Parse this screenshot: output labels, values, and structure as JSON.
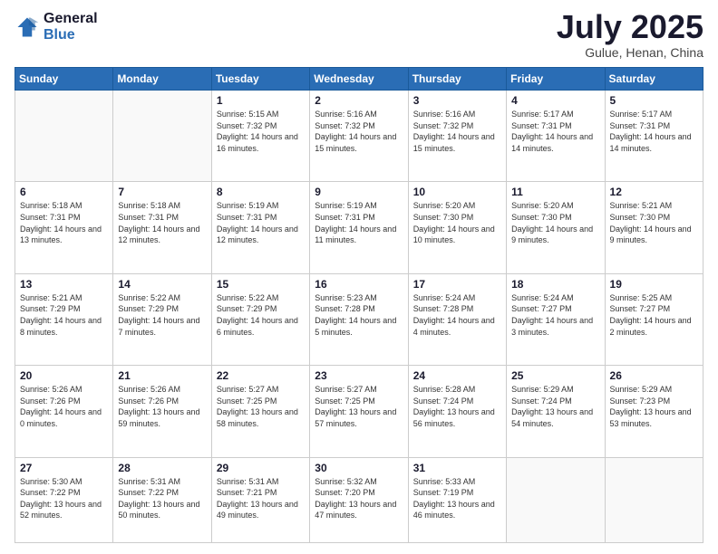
{
  "header": {
    "logo_general": "General",
    "logo_blue": "Blue",
    "month_title": "July 2025",
    "subtitle": "Gulue, Henan, China"
  },
  "weekdays": [
    "Sunday",
    "Monday",
    "Tuesday",
    "Wednesday",
    "Thursday",
    "Friday",
    "Saturday"
  ],
  "weeks": [
    [
      {
        "day": "",
        "info": ""
      },
      {
        "day": "",
        "info": ""
      },
      {
        "day": "1",
        "info": "Sunrise: 5:15 AM\nSunset: 7:32 PM\nDaylight: 14 hours and 16 minutes."
      },
      {
        "day": "2",
        "info": "Sunrise: 5:16 AM\nSunset: 7:32 PM\nDaylight: 14 hours and 15 minutes."
      },
      {
        "day": "3",
        "info": "Sunrise: 5:16 AM\nSunset: 7:32 PM\nDaylight: 14 hours and 15 minutes."
      },
      {
        "day": "4",
        "info": "Sunrise: 5:17 AM\nSunset: 7:31 PM\nDaylight: 14 hours and 14 minutes."
      },
      {
        "day": "5",
        "info": "Sunrise: 5:17 AM\nSunset: 7:31 PM\nDaylight: 14 hours and 14 minutes."
      }
    ],
    [
      {
        "day": "6",
        "info": "Sunrise: 5:18 AM\nSunset: 7:31 PM\nDaylight: 14 hours and 13 minutes."
      },
      {
        "day": "7",
        "info": "Sunrise: 5:18 AM\nSunset: 7:31 PM\nDaylight: 14 hours and 12 minutes."
      },
      {
        "day": "8",
        "info": "Sunrise: 5:19 AM\nSunset: 7:31 PM\nDaylight: 14 hours and 12 minutes."
      },
      {
        "day": "9",
        "info": "Sunrise: 5:19 AM\nSunset: 7:31 PM\nDaylight: 14 hours and 11 minutes."
      },
      {
        "day": "10",
        "info": "Sunrise: 5:20 AM\nSunset: 7:30 PM\nDaylight: 14 hours and 10 minutes."
      },
      {
        "day": "11",
        "info": "Sunrise: 5:20 AM\nSunset: 7:30 PM\nDaylight: 14 hours and 9 minutes."
      },
      {
        "day": "12",
        "info": "Sunrise: 5:21 AM\nSunset: 7:30 PM\nDaylight: 14 hours and 9 minutes."
      }
    ],
    [
      {
        "day": "13",
        "info": "Sunrise: 5:21 AM\nSunset: 7:29 PM\nDaylight: 14 hours and 8 minutes."
      },
      {
        "day": "14",
        "info": "Sunrise: 5:22 AM\nSunset: 7:29 PM\nDaylight: 14 hours and 7 minutes."
      },
      {
        "day": "15",
        "info": "Sunrise: 5:22 AM\nSunset: 7:29 PM\nDaylight: 14 hours and 6 minutes."
      },
      {
        "day": "16",
        "info": "Sunrise: 5:23 AM\nSunset: 7:28 PM\nDaylight: 14 hours and 5 minutes."
      },
      {
        "day": "17",
        "info": "Sunrise: 5:24 AM\nSunset: 7:28 PM\nDaylight: 14 hours and 4 minutes."
      },
      {
        "day": "18",
        "info": "Sunrise: 5:24 AM\nSunset: 7:27 PM\nDaylight: 14 hours and 3 minutes."
      },
      {
        "day": "19",
        "info": "Sunrise: 5:25 AM\nSunset: 7:27 PM\nDaylight: 14 hours and 2 minutes."
      }
    ],
    [
      {
        "day": "20",
        "info": "Sunrise: 5:26 AM\nSunset: 7:26 PM\nDaylight: 14 hours and 0 minutes."
      },
      {
        "day": "21",
        "info": "Sunrise: 5:26 AM\nSunset: 7:26 PM\nDaylight: 13 hours and 59 minutes."
      },
      {
        "day": "22",
        "info": "Sunrise: 5:27 AM\nSunset: 7:25 PM\nDaylight: 13 hours and 58 minutes."
      },
      {
        "day": "23",
        "info": "Sunrise: 5:27 AM\nSunset: 7:25 PM\nDaylight: 13 hours and 57 minutes."
      },
      {
        "day": "24",
        "info": "Sunrise: 5:28 AM\nSunset: 7:24 PM\nDaylight: 13 hours and 56 minutes."
      },
      {
        "day": "25",
        "info": "Sunrise: 5:29 AM\nSunset: 7:24 PM\nDaylight: 13 hours and 54 minutes."
      },
      {
        "day": "26",
        "info": "Sunrise: 5:29 AM\nSunset: 7:23 PM\nDaylight: 13 hours and 53 minutes."
      }
    ],
    [
      {
        "day": "27",
        "info": "Sunrise: 5:30 AM\nSunset: 7:22 PM\nDaylight: 13 hours and 52 minutes."
      },
      {
        "day": "28",
        "info": "Sunrise: 5:31 AM\nSunset: 7:22 PM\nDaylight: 13 hours and 50 minutes."
      },
      {
        "day": "29",
        "info": "Sunrise: 5:31 AM\nSunset: 7:21 PM\nDaylight: 13 hours and 49 minutes."
      },
      {
        "day": "30",
        "info": "Sunrise: 5:32 AM\nSunset: 7:20 PM\nDaylight: 13 hours and 47 minutes."
      },
      {
        "day": "31",
        "info": "Sunrise: 5:33 AM\nSunset: 7:19 PM\nDaylight: 13 hours and 46 minutes."
      },
      {
        "day": "",
        "info": ""
      },
      {
        "day": "",
        "info": ""
      }
    ]
  ]
}
